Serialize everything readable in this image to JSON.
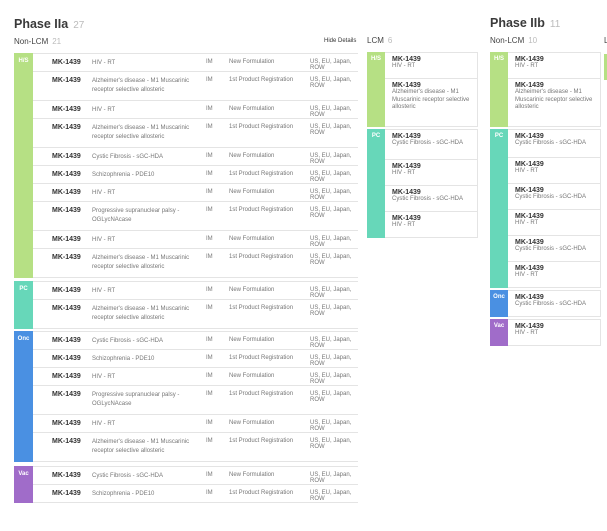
{
  "colors": {
    "HIV": "#b6e084",
    "PC": "#67d7b9",
    "Onc": "#4a90e2",
    "Vac": "#a06cc9"
  },
  "phase_iia": {
    "title": "Phase IIa",
    "count": "27",
    "non_lcm": {
      "label": "Non-LCM",
      "count": "21",
      "hide_details": "Hide Details",
      "groups": [
        {
          "badge": "H/S",
          "color_key": "HIV",
          "rows": [
            {
              "drug": "MK-1439",
              "indication": "HIV - RT",
              "route": "IM",
              "type": "New Formulation",
              "markets": "US, EU, Japan, ROW"
            },
            {
              "drug": "MK-1439",
              "indication": "Alzheimer's disease - M1 Muscarinic receptor selective allosteric",
              "route": "IM",
              "type": "1st Product Registration",
              "markets": "US, EU, Japan, ROW"
            },
            {
              "drug": "MK-1439",
              "indication": "HIV - RT",
              "route": "IM",
              "type": "New Formulation",
              "markets": "US, EU, Japan, ROW"
            },
            {
              "drug": "MK-1439",
              "indication": "Alzheimer's disease - M1 Muscarinic receptor selective allosteric",
              "route": "IM",
              "type": "1st Product Registration",
              "markets": "US, EU, Japan, ROW"
            },
            {
              "drug": "MK-1439",
              "indication": "Cystic Fibrosis - sGC-HDA",
              "route": "IM",
              "type": "New Formulation",
              "markets": "US, EU, Japan, ROW"
            },
            {
              "drug": "MK-1439",
              "indication": "Schizophrenia - PDE10",
              "route": "IM",
              "type": "1st Product Registration",
              "markets": "US, EU, Japan, ROW"
            },
            {
              "drug": "MK-1439",
              "indication": "HIV - RT",
              "route": "IM",
              "type": "New Formulation",
              "markets": "US, EU, Japan, ROW"
            },
            {
              "drug": "MK-1439",
              "indication": "Progressive supranuclear palsy - OGLycNAcase",
              "route": "IM",
              "type": "1st Product Registration",
              "markets": "US, EU, Japan, ROW"
            },
            {
              "drug": "MK-1439",
              "indication": "HIV - RT",
              "route": "IM",
              "type": "New Formulation",
              "markets": "US, EU, Japan, ROW"
            },
            {
              "drug": "MK-1439",
              "indication": "Alzheimer's disease - M1 Muscarinic receptor selective allosteric",
              "route": "IM",
              "type": "1st Product Registration",
              "markets": "US, EU, Japan, ROW"
            }
          ]
        },
        {
          "badge": "PC",
          "color_key": "PC",
          "rows": [
            {
              "drug": "MK-1439",
              "indication": "HIV - RT",
              "route": "IM",
              "type": "New Formulation",
              "markets": "US, EU, Japan, ROW"
            },
            {
              "drug": "MK-1439",
              "indication": "Alzheimer's disease - M1 Muscarinic receptor selective allosteric",
              "route": "IM",
              "type": "1st Product Registration",
              "markets": "US, EU, Japan, ROW"
            }
          ]
        },
        {
          "badge": "Onc",
          "color_key": "Onc",
          "rows": [
            {
              "drug": "MK-1439",
              "indication": "Cystic Fibrosis - sGC-HDA",
              "route": "IM",
              "type": "New Formulation",
              "markets": "US, EU, Japan, ROW"
            },
            {
              "drug": "MK-1439",
              "indication": "Schizophrenia - PDE10",
              "route": "IM",
              "type": "1st Product Registration",
              "markets": "US, EU, Japan, ROW"
            },
            {
              "drug": "MK-1439",
              "indication": "HIV - RT",
              "route": "IM",
              "type": "New Formulation",
              "markets": "US, EU, Japan, ROW"
            },
            {
              "drug": "MK-1439",
              "indication": "Progressive supranuclear palsy - OGLycNAcase",
              "route": "IM",
              "type": "1st Product Registration",
              "markets": "US, EU, Japan, ROW"
            },
            {
              "drug": "MK-1439",
              "indication": "HIV - RT",
              "route": "IM",
              "type": "New Formulation",
              "markets": "US, EU, Japan, ROW"
            },
            {
              "drug": "MK-1439",
              "indication": "Alzheimer's disease - M1 Muscarinic receptor selective allosteric",
              "route": "IM",
              "type": "1st Product Registration",
              "markets": "US, EU, Japan, ROW"
            }
          ]
        },
        {
          "badge": "Vac",
          "color_key": "Vac",
          "rows": [
            {
              "drug": "MK-1439",
              "indication": "Cystic Fibrosis - sGC-HDA",
              "route": "IM",
              "type": "New Formulation",
              "markets": "US, EU, Japan, ROW"
            },
            {
              "drug": "MK-1439",
              "indication": "Schizophrenia - PDE10",
              "route": "IM",
              "type": "1st Product Registration",
              "markets": "US, EU, Japan, ROW"
            }
          ]
        }
      ]
    },
    "lcm": {
      "label": "LCM",
      "count": "6",
      "groups": [
        {
          "badge": "H/S",
          "color_key": "HIV",
          "cards": [
            {
              "drug": "MK-1439",
              "indication": "HIV - RT"
            },
            {
              "drug": "MK-1439",
              "indication": "Alzheimer's disease - M1 Muscarinic receptor selective allosteric"
            }
          ]
        },
        {
          "badge": "PC",
          "color_key": "PC",
          "cards": [
            {
              "drug": "MK-1439",
              "indication": "Cystic Fibrosis - sGC-HDA"
            },
            {
              "drug": "MK-1439",
              "indication": "HIV - RT"
            },
            {
              "drug": "MK-1439",
              "indication": "Cystic Fibrosis - sGC-HDA"
            },
            {
              "drug": "MK-1439",
              "indication": "HIV - RT"
            }
          ]
        }
      ]
    }
  },
  "phase_iib": {
    "title": "Phase IIb",
    "count": "11",
    "non_lcm": {
      "label": "Non-LCM",
      "count": "10",
      "groups": [
        {
          "badge": "H/S",
          "color_key": "HIV",
          "cards": [
            {
              "drug": "MK-1439",
              "indication": "HIV - RT"
            },
            {
              "drug": "MK-1439",
              "indication": "Alzheimer's disease - M1 Muscarinic receptor selective allosteric"
            }
          ]
        },
        {
          "badge": "PC",
          "color_key": "PC",
          "cards": [
            {
              "drug": "MK-1439",
              "indication": "Cystic Fibrosis - sGC-HDA"
            },
            {
              "drug": "MK-1439",
              "indication": "HIV - RT"
            },
            {
              "drug": "MK-1439",
              "indication": "Cystic Fibrosis - sGC-HDA"
            },
            {
              "drug": "MK-1439",
              "indication": "HIV - RT"
            },
            {
              "drug": "MK-1439",
              "indication": "Cystic Fibrosis - sGC-HDA"
            },
            {
              "drug": "MK-1439",
              "indication": "HIV - RT"
            }
          ]
        },
        {
          "badge": "Onc",
          "color_key": "Onc",
          "cards": [
            {
              "drug": "MK-1439",
              "indication": "Cystic Fibrosis - sGC-HDA"
            }
          ]
        },
        {
          "badge": "Vac",
          "color_key": "Vac",
          "cards": [
            {
              "drug": "MK-1439",
              "indication": "HIV - RT"
            }
          ]
        }
      ]
    },
    "clipped_label": "L"
  }
}
